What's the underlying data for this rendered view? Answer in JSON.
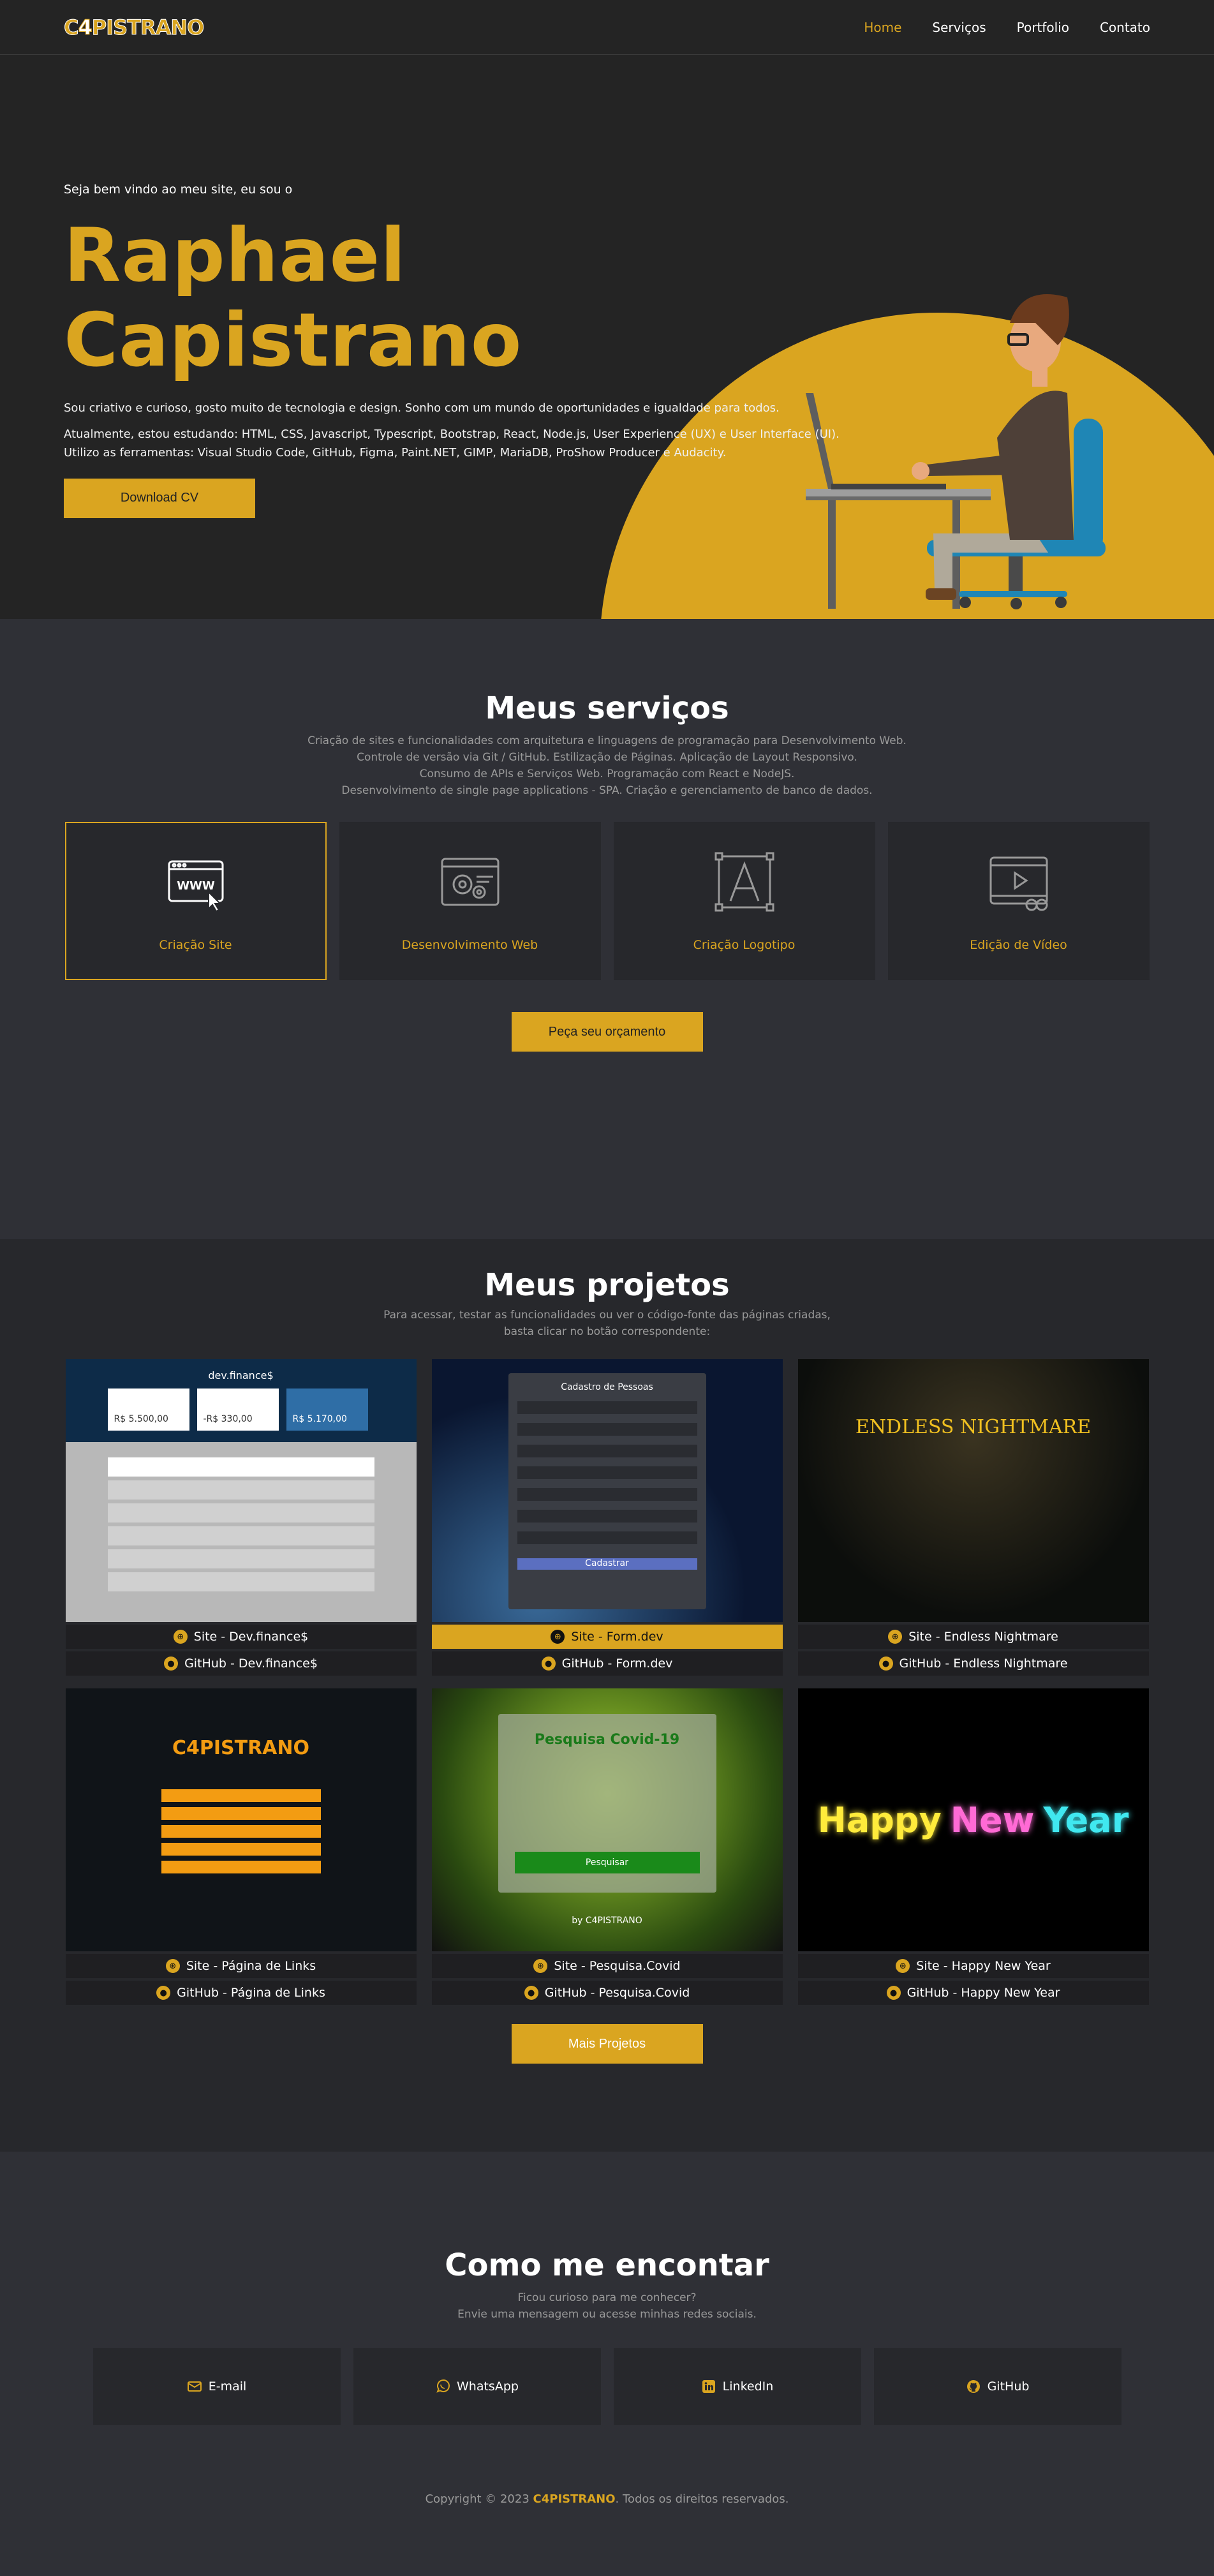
{
  "header": {
    "logo_pre": "C",
    "logo_four": "4",
    "logo_post": "PISTRANO",
    "nav": [
      {
        "label": "Home"
      },
      {
        "label": "Serviços"
      },
      {
        "label": "Portfolio"
      },
      {
        "label": "Contato"
      }
    ]
  },
  "hero": {
    "greeting": "Seja bem vindo ao meu site, eu sou o",
    "name": "Raphael Capistrano",
    "intro": "Sou criativo e curioso, gosto muito de tecnologia e design. Sonho com um mundo de oportunidades e igualdade para todos.",
    "studying": "Atualmente, estou estudando: HTML, CSS, Javascript, Typescript, Bootstrap, React, Node.js, User Experience (UX) e User Interface (UI).",
    "tools": "Utilizo as ferramentas: Visual Studio Code, GitHub, Figma, Paint.NET, GIMP, MariaDB, ProShow Producer e Audacity.",
    "cv_button": "Download CV"
  },
  "services": {
    "title": "Meus serviços",
    "lines": [
      "Criação de sites e funcionalidades com arquitetura e linguagens de programação para Desenvolvimento Web.",
      "Controle de versão via Git / GitHub. Estilização de Páginas. Aplicação de Layout Responsivo.",
      "Consumo de APIs e Serviços Web. Programação com React e NodeJS.",
      "Desenvolvimento de single page applications - SPA. Criação e gerenciamento de banco de dados."
    ],
    "cards": [
      {
        "label": "Criação Site",
        "icon": "www-icon"
      },
      {
        "label": "Desenvolvimento Web",
        "icon": "web-dev-icon"
      },
      {
        "label": "Criação Logotipo",
        "icon": "logo-design-icon"
      },
      {
        "label": "Edição de Vídeo",
        "icon": "video-edit-icon"
      }
    ],
    "button": "Peça seu orçamento"
  },
  "projects": {
    "title": "Meus projetos",
    "sub1": "Para acessar, testar as funcionalidades ou ver o código-fonte das páginas criadas,",
    "sub2": "basta clicar no botão correspondente:",
    "items": [
      {
        "site": "Site - Dev.finance$",
        "github": "GitHub - Dev.finance$",
        "thumb_title": "dev.finance$",
        "c1": "R$ 5.500,00",
        "c2": "-R$ 330,00",
        "c3": "R$ 5.170,00"
      },
      {
        "site": "Site - Form.dev",
        "github": "GitHub - Form.dev",
        "thumb_title": "Cadastro de Pessoas",
        "thumb_btn": "Cadastrar"
      },
      {
        "site": "Site - Endless Nightmare",
        "github": "GitHub - Endless Nightmare",
        "thumb_title": "ENDLESS NIGHTMARE"
      },
      {
        "site": "Site - Página de Links",
        "github": "GitHub - Página de Links",
        "thumb_title": "C4PISTRANO"
      },
      {
        "site": "Site - Pesquisa.Covid",
        "github": "GitHub - Pesquisa.Covid",
        "thumb_title": "Pesquisa Covid-19",
        "thumb_btn": "Pesquisar",
        "thumb_by": "by C4PISTRANO"
      },
      {
        "site": "Site - Happy New Year",
        "github": "GitHub - Happy New Year",
        "w1": "Happy",
        "w2": "New",
        "w3": "Year"
      }
    ],
    "button": "Mais Projetos"
  },
  "contact": {
    "title": "Como me encontar",
    "sub1": "Ficou curioso para me conhecer?",
    "sub2": "Envie uma mensagem ou acesse minhas redes sociais.",
    "links": [
      {
        "label": "E-mail",
        "icon": "email-icon"
      },
      {
        "label": "WhatsApp",
        "icon": "whatsapp-icon"
      },
      {
        "label": "LinkedIn",
        "icon": "linkedin-icon"
      },
      {
        "label": "GitHub",
        "icon": "github-icon"
      }
    ]
  },
  "footer": {
    "pre": "Copyright © 2023 ",
    "brand": "C4PISTRANO",
    "post": ". Todos os direitos reservados."
  },
  "colors": {
    "accent": "#daa520",
    "dark": "#242424",
    "section": "#2f3036",
    "card": "#27282c"
  }
}
